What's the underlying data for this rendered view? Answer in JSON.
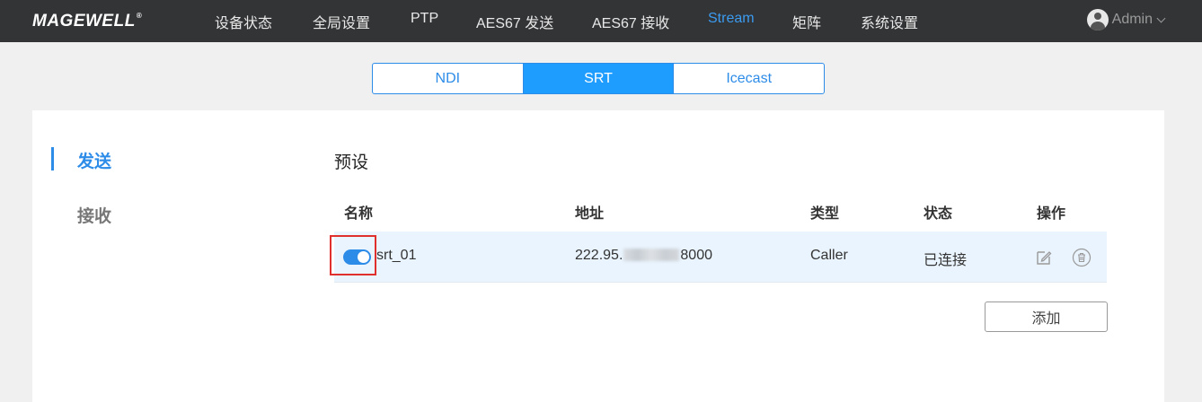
{
  "header": {
    "logo": "MAGEWELL",
    "logo_mark": "®",
    "nav": [
      {
        "label": "设备状态"
      },
      {
        "label": "全局设置"
      },
      {
        "label": "PTP"
      },
      {
        "label": "AES67 发送"
      },
      {
        "label": "AES67 接收"
      },
      {
        "label": "Stream"
      },
      {
        "label": "矩阵"
      },
      {
        "label": "系统设置"
      }
    ],
    "active_nav": "Stream",
    "user": "Admin"
  },
  "tabs": [
    {
      "label": "NDI"
    },
    {
      "label": "SRT"
    },
    {
      "label": "Icecast"
    }
  ],
  "active_tab": "SRT",
  "sidebar": {
    "items": [
      {
        "label": "发送"
      },
      {
        "label": "接收"
      }
    ],
    "active": "发送"
  },
  "section": {
    "title": "预设"
  },
  "table": {
    "headers": [
      "名称",
      "地址",
      "类型",
      "状态",
      "操作"
    ],
    "rows": [
      {
        "enabled": true,
        "name": "srt_01",
        "address_prefix": "222.95.",
        "address_suffix": "8000",
        "type": "Caller",
        "status": "已连接",
        "actions": [
          "edit-icon",
          "delete-icon"
        ]
      }
    ]
  },
  "add_button": "添加",
  "colors": {
    "accent": "#2d8ce8",
    "active_tab": "#1f9dff",
    "topbar": "#333436",
    "highlight": "#e0302e"
  }
}
